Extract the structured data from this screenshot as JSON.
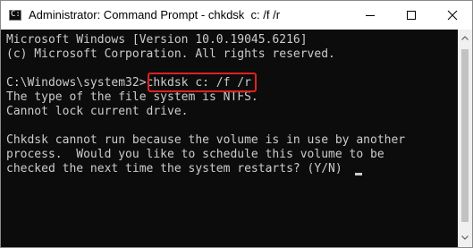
{
  "window": {
    "title": "Administrator: Command Prompt - chkdsk  c: /f /r",
    "icon": "command-prompt-icon",
    "icon_glyph": "C:\\"
  },
  "controls": {
    "minimize_icon": "minimize-icon",
    "maximize_icon": "maximize-icon",
    "close_icon": "close-icon"
  },
  "console": {
    "lines": [
      "Microsoft Windows [Version 10.0.19045.6216]",
      "(c) Microsoft Corporation. All rights reserved.",
      "",
      "C:\\Windows\\system32>chkdsk c: /f /r",
      "The type of the file system is NTFS.",
      "Cannot lock current drive.",
      "",
      "Chkdsk cannot run because the volume is in use by another",
      "process.  Would you like to schedule this volume to be",
      "checked the next time the system restarts? (Y/N)"
    ],
    "highlighted_command": "chkdsk c: /f /r",
    "highlight_color": "#e02020",
    "text_color": "#cccccc",
    "background_color": "#0c0c0c"
  },
  "scrollbar": {
    "up_icon": "scroll-up-arrow-icon",
    "down_icon": "scroll-down-arrow-icon"
  }
}
